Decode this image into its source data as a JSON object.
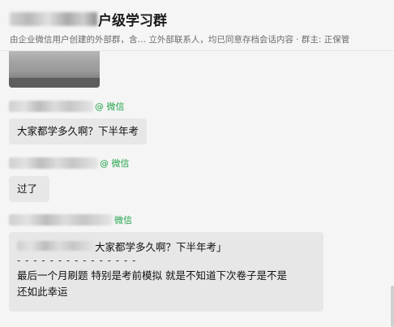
{
  "header": {
    "title_suffix": "户级学习群",
    "subtitle": "由企业微信用户创建的外部群，含… 立外部联系人，均已同意存档会话内容 · 群主: 正保管"
  },
  "messages": [
    {
      "source_tag": "@ 微信",
      "text": "大家都学多久啊？下半年考"
    },
    {
      "source_tag": "@ 微信",
      "text": "过了"
    },
    {
      "source_tag": "微信",
      "quoted_text": "大家都学多久啊？下半年考」",
      "divider": "- - - - - - - - - - - - - - -",
      "lines": [
        "最后一个月刷题  特别是考前模拟  就是不知道下次卷子是不是",
        "还如此幸运"
      ]
    }
  ]
}
